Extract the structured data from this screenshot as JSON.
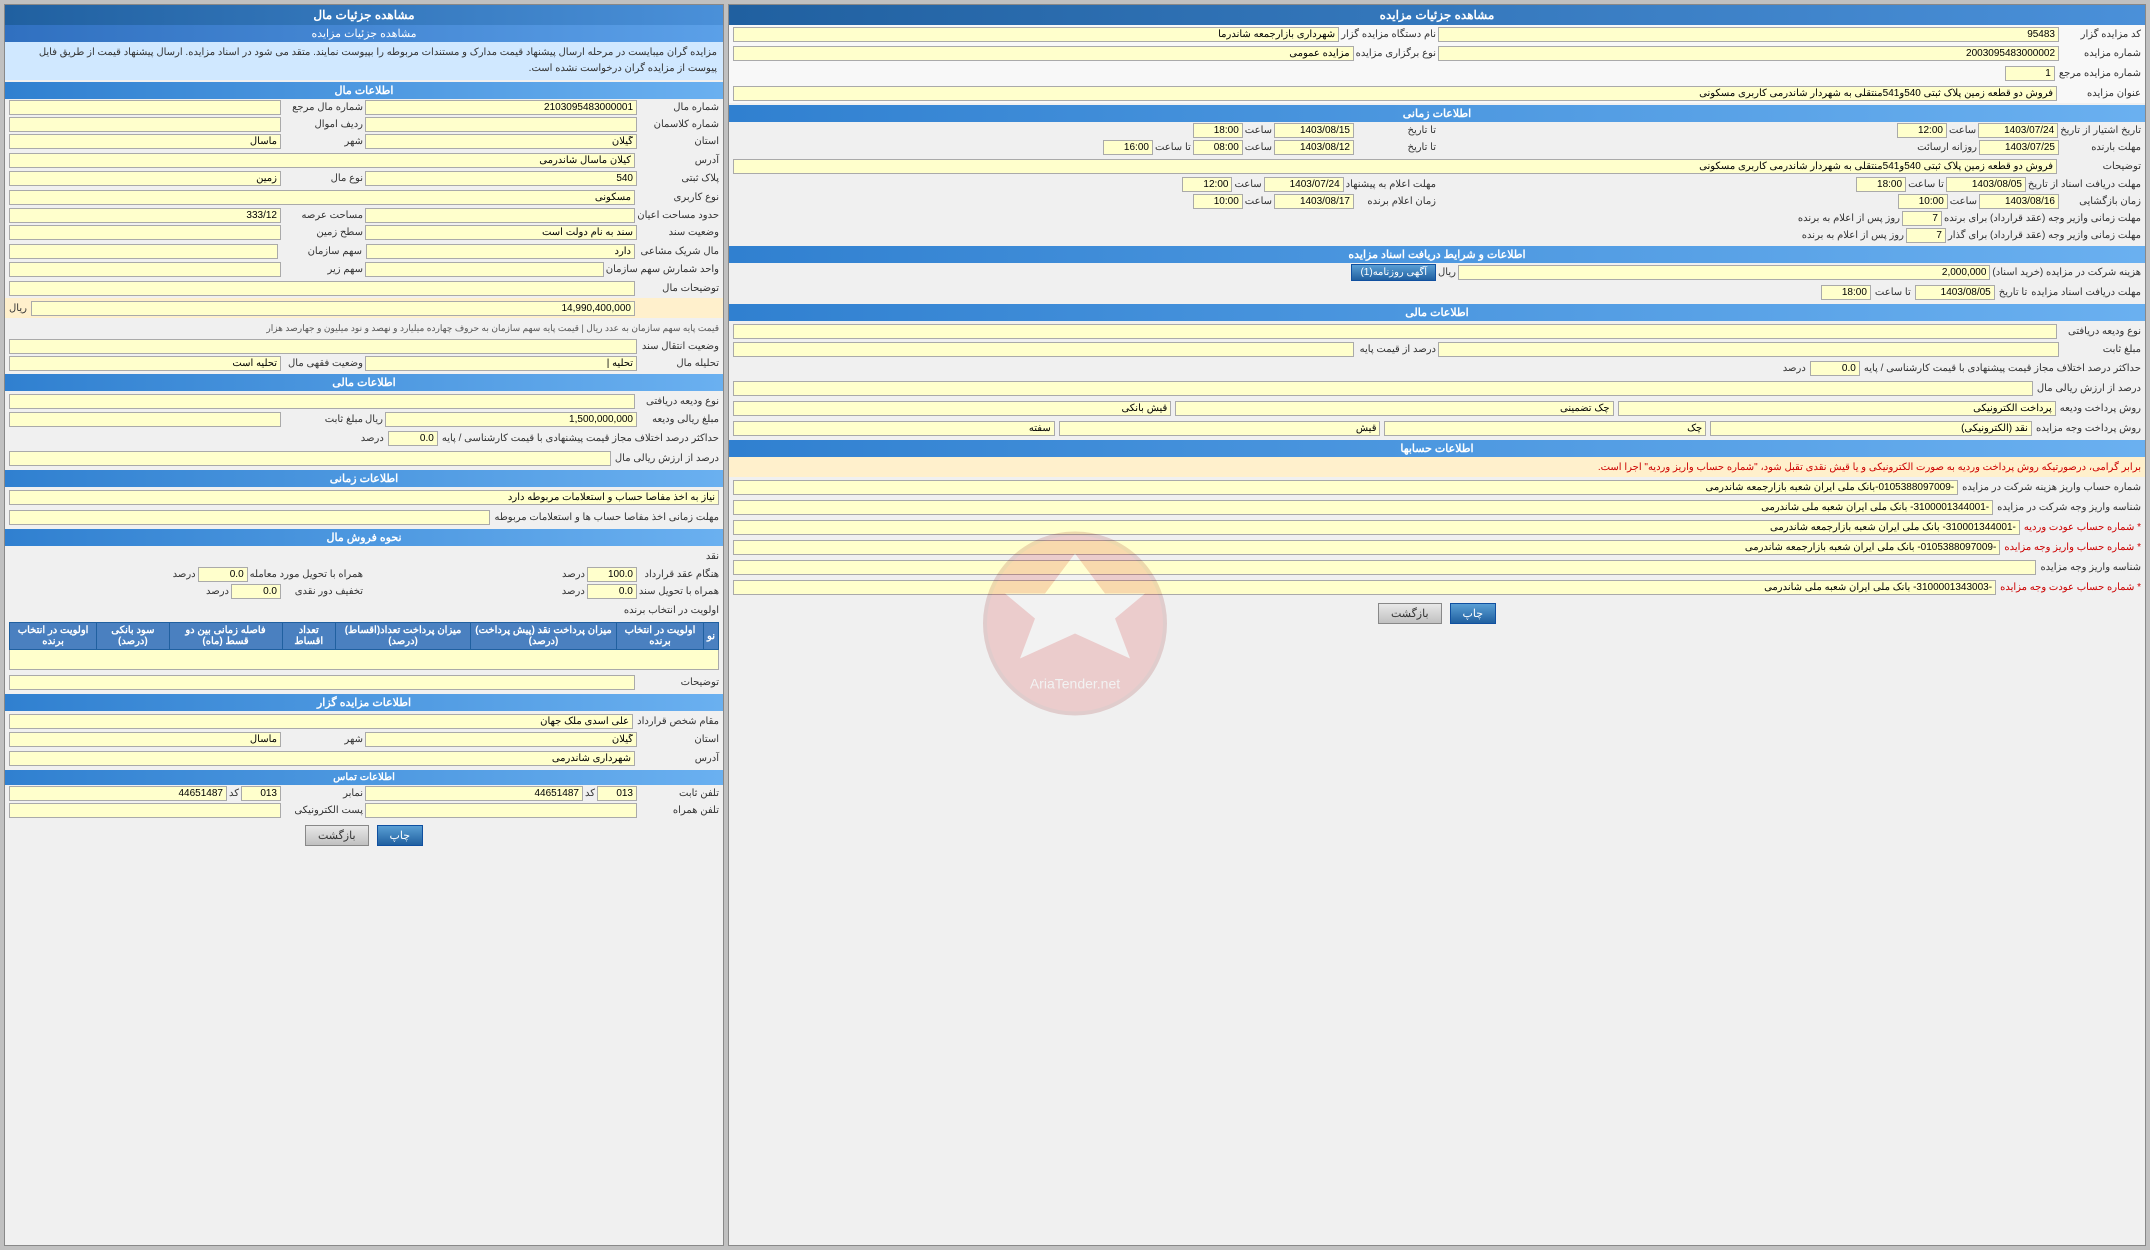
{
  "left_panel": {
    "header": "مشاهده جزئیات مال",
    "sub_header": "مشاهده جزئیات مزایده",
    "info_text": "مزایده گران میبایست در مرحله ارسال پیشنهاد قیمت مدارک و مستندات مربوطه را بپیوست نمایند. متقد می شود در اسناد مزایده. ارسال پیشنهاد قیمت از طریق فایل پیوست از مزایده گران درخواست نشده است.",
    "sections": {
      "mal_info": {
        "title": "اطلاعات مال",
        "shomare_mal": "2103095483000001",
        "shomare_mal_marja": "",
        "shomare_klassman": "",
        "radif_amval": "",
        "shomare_masal": "ماسال",
        "shahr": "",
        "ostan": "گیلان",
        "address": "کیلان ماسال شاندرمی",
        "plak": "540",
        "nav_mal": "زمین",
        "nav_karbari": "مسکونی",
        "hodood_masahat": "",
        "masahat_arsa": "333/12",
        "vaziat_sanad": "سند به نام دولت است",
        "sath_zamin": "",
        "mal_sharik_mashayi": "دارد",
        "shomare_sahm": "",
        "sahm_sarman": "",
        "sahm_zir": "",
        "tazvihat_mal": "",
        "qimat_paye": "14,990,400,000",
        "qimat_desc": "قیمت پایه سهم سازمان به عدد ریال | قیمت پایه سهم سازمان به حروف چهارده میلیارد و نهصد و نود میلیون و جهارصد هزار",
        "vaziat_entqal": "وضعیت انتقال سند",
        "vaziat_feqhi": "وضعیت فقهی مال | تحلیه است",
        "tahlile_mal": "تحلیه |"
      },
      "mali": {
        "title": "اطلاعات مالی",
        "nav_varide_daryafti": "",
        "mablagh_riali": "1,500,000,000",
        "mablagh_sabt": "",
        "darsad_ekhtlaf": "0.0",
        "darsad_riali_mal": ""
      },
      "zamani": {
        "title": "اطلاعات زمانی",
        "niaz": "نیاز به اخذ مفاصا حساب و استعلامات مربوطه دارد",
        "mohlat": "مهلت زمانی اخذ مفاصا حساب ها و استعلامات مربوطه"
      },
      "forosh": {
        "title": "نحوه فروش مال",
        "naghd_label": "نقد",
        "hengam_aqd": "100.0",
        "hamrah_tatbiq": "0.0",
        "tahvil_sanad": "0.0",
        "takhfif_naghd": "0.0",
        "avvalviat": "اولویت در انتخاب برنده",
        "table_headers": [
          "نو",
          "اولویت در انتخاب برنده",
          "میزان پرداخت نقد (پیش پرداخت) (درصد)",
          "میزان پرداخت تعداد(اقساط) (درصد)",
          "تعداد اقساط",
          "فاصله زمانی بین دو قسط (ماه)",
          "سود بانکی (درصد)",
          "اولویت در انتخاب برنده"
        ],
        "table_rows": [],
        "tazvihat_label": "توضیحات"
      },
      "mozayede_gar": {
        "title": "اطلاعات مزایده گزار",
        "moqam": "علی اسدی ملک جهان",
        "shomare_masal": "ماسال",
        "shahr": "",
        "ostan": "گیلان",
        "address": "شهرداری شاندرمی",
        "tamas_title": "اطلاعات تماس",
        "telefon_sabt": "44651487",
        "kd_sabt": "013",
        "namabr": "44651487",
        "kd_namabr": "013",
        "telefon_hamrah": "",
        "post_electroniki": ""
      }
    },
    "buttons": {
      "chap": "چاپ",
      "bazgasht": "بازگشت"
    }
  },
  "right_panel": {
    "header": "مشاهده جزئیات مزایده",
    "fields": {
      "code_mozayede": "95483",
      "name_dastgah": "شهرداری بازارجمعه شاندرما",
      "shomare_mozayede": "2003095483000002",
      "nav_bargozari": "مزایده عمومی",
      "shomare_mozayede_marja": "1",
      "onvan": "فروش دو قطعه زمین پلاک ثبتی 540و541منتقلی به شهردار شاندرمی کاربری مسکونی"
    },
    "zamani": {
      "title": "اطلاعات زمانی",
      "tarikh_shoro": "1403/07/24",
      "saaat_shoro": "12:00",
      "tarikh_payan": "1403/08/15",
      "saaat_payan": "18:00",
      "mohlat_barende": "1403/07/25",
      "roz_ersal": "روزانه ارسائت",
      "saaat_ersal_start": "08:00",
      "tarikh_ersal_end": "1403/08/12",
      "saaat_ersal_end": "16:00",
      "tazvihat": "فروش دو قطعه زمین پلاک ثبتی 540و541منتقلی به شهردار شاندرمی کاربری مسکونی",
      "mohlat_asnad_start": "1403/08/05",
      "saaat_asnad_start": "18:00",
      "mohlat_asnad_end": "1403/07/24",
      "saaat_asnad_end": "12:00",
      "mohlat_pishnahad_start": "1403/08/16",
      "saaat_pishnahad_start": "10:00",
      "zaman_bargozari": "1403/08/17",
      "saaat_bargozari": "10:00",
      "zaman_elam_barende": "1403/08/17",
      "saaat_elam_barende": "10:00",
      "mohlat_zamanei_aqd": "7",
      "mohlat_zamanei_gharar": "7"
    },
    "asnad": {
      "title": "اطلاعات و شرایط دریافت اسناد مزایده",
      "hazine": "2,000,000",
      "mohlat_daryaft_tarikh": "1403/08/05",
      "mohlat_daryaft_saaat": "18:00",
      "akhi_btn": "آگهی روزنامه(1)"
    },
    "mali": {
      "title": "اطلاعات مالی",
      "nav_varide": "",
      "mablagh_sabt": "",
      "darsad_qimat": "0.0",
      "darsad_riali": "",
      "rosh_pardakht_varide": "پرداخت الکترونیکی",
      "chek_tazmin": "چک تضمینی",
      "qish_banki": "قیش بانکی",
      "rosh_pardakht_vojh": "نقد (الکترونیکی)",
      "chek": "چک",
      "qish": "قیش",
      "safte": "سفته"
    },
    "hesabha": {
      "title": "اطلاعات حسابها",
      "warning": "برابر گرامی، درصورتیکه روش پرداخت وردیه به صورت الکترونیکی و یا قیش نقدی تقبل شود، \"شماره حساب واریز وردیه\" اجرا است.",
      "shomare_hesab1": "-0105388097009-بانک ملی ایران شعبه بازارجمعه شاندرمی",
      "label1": "شماره حساب واریز هزینه شرکت در مزایده",
      "shomare_hesab2": "-3100001344001- بانک ملی ایران شعبه ملی شاندرمی",
      "label2": "شناسه واریز وجه شرکت در مزایده",
      "shomare_hesab3": "-310001344001- بانک ملی ایران شعبه بازارجمعه شاندرمی",
      "label3": "شماره حساب عودت وردیه",
      "shomare_hesab4": "-0105388097009- بانک ملی ایران شعبه بازارجمعه شاندرمی",
      "label4": "شماره حساب واریز وجه مزایده",
      "shomare_hesab5": "-3100001343003- بانک ملی ایران شعبه ملی شاندرمی",
      "label5": "شماره حساب عودت وجه مزایده",
      "shoname_variz": "شناسه واریز وجه مزایده"
    },
    "buttons": {
      "chap": "چاپ",
      "bazgasht": "بازگشت"
    }
  }
}
